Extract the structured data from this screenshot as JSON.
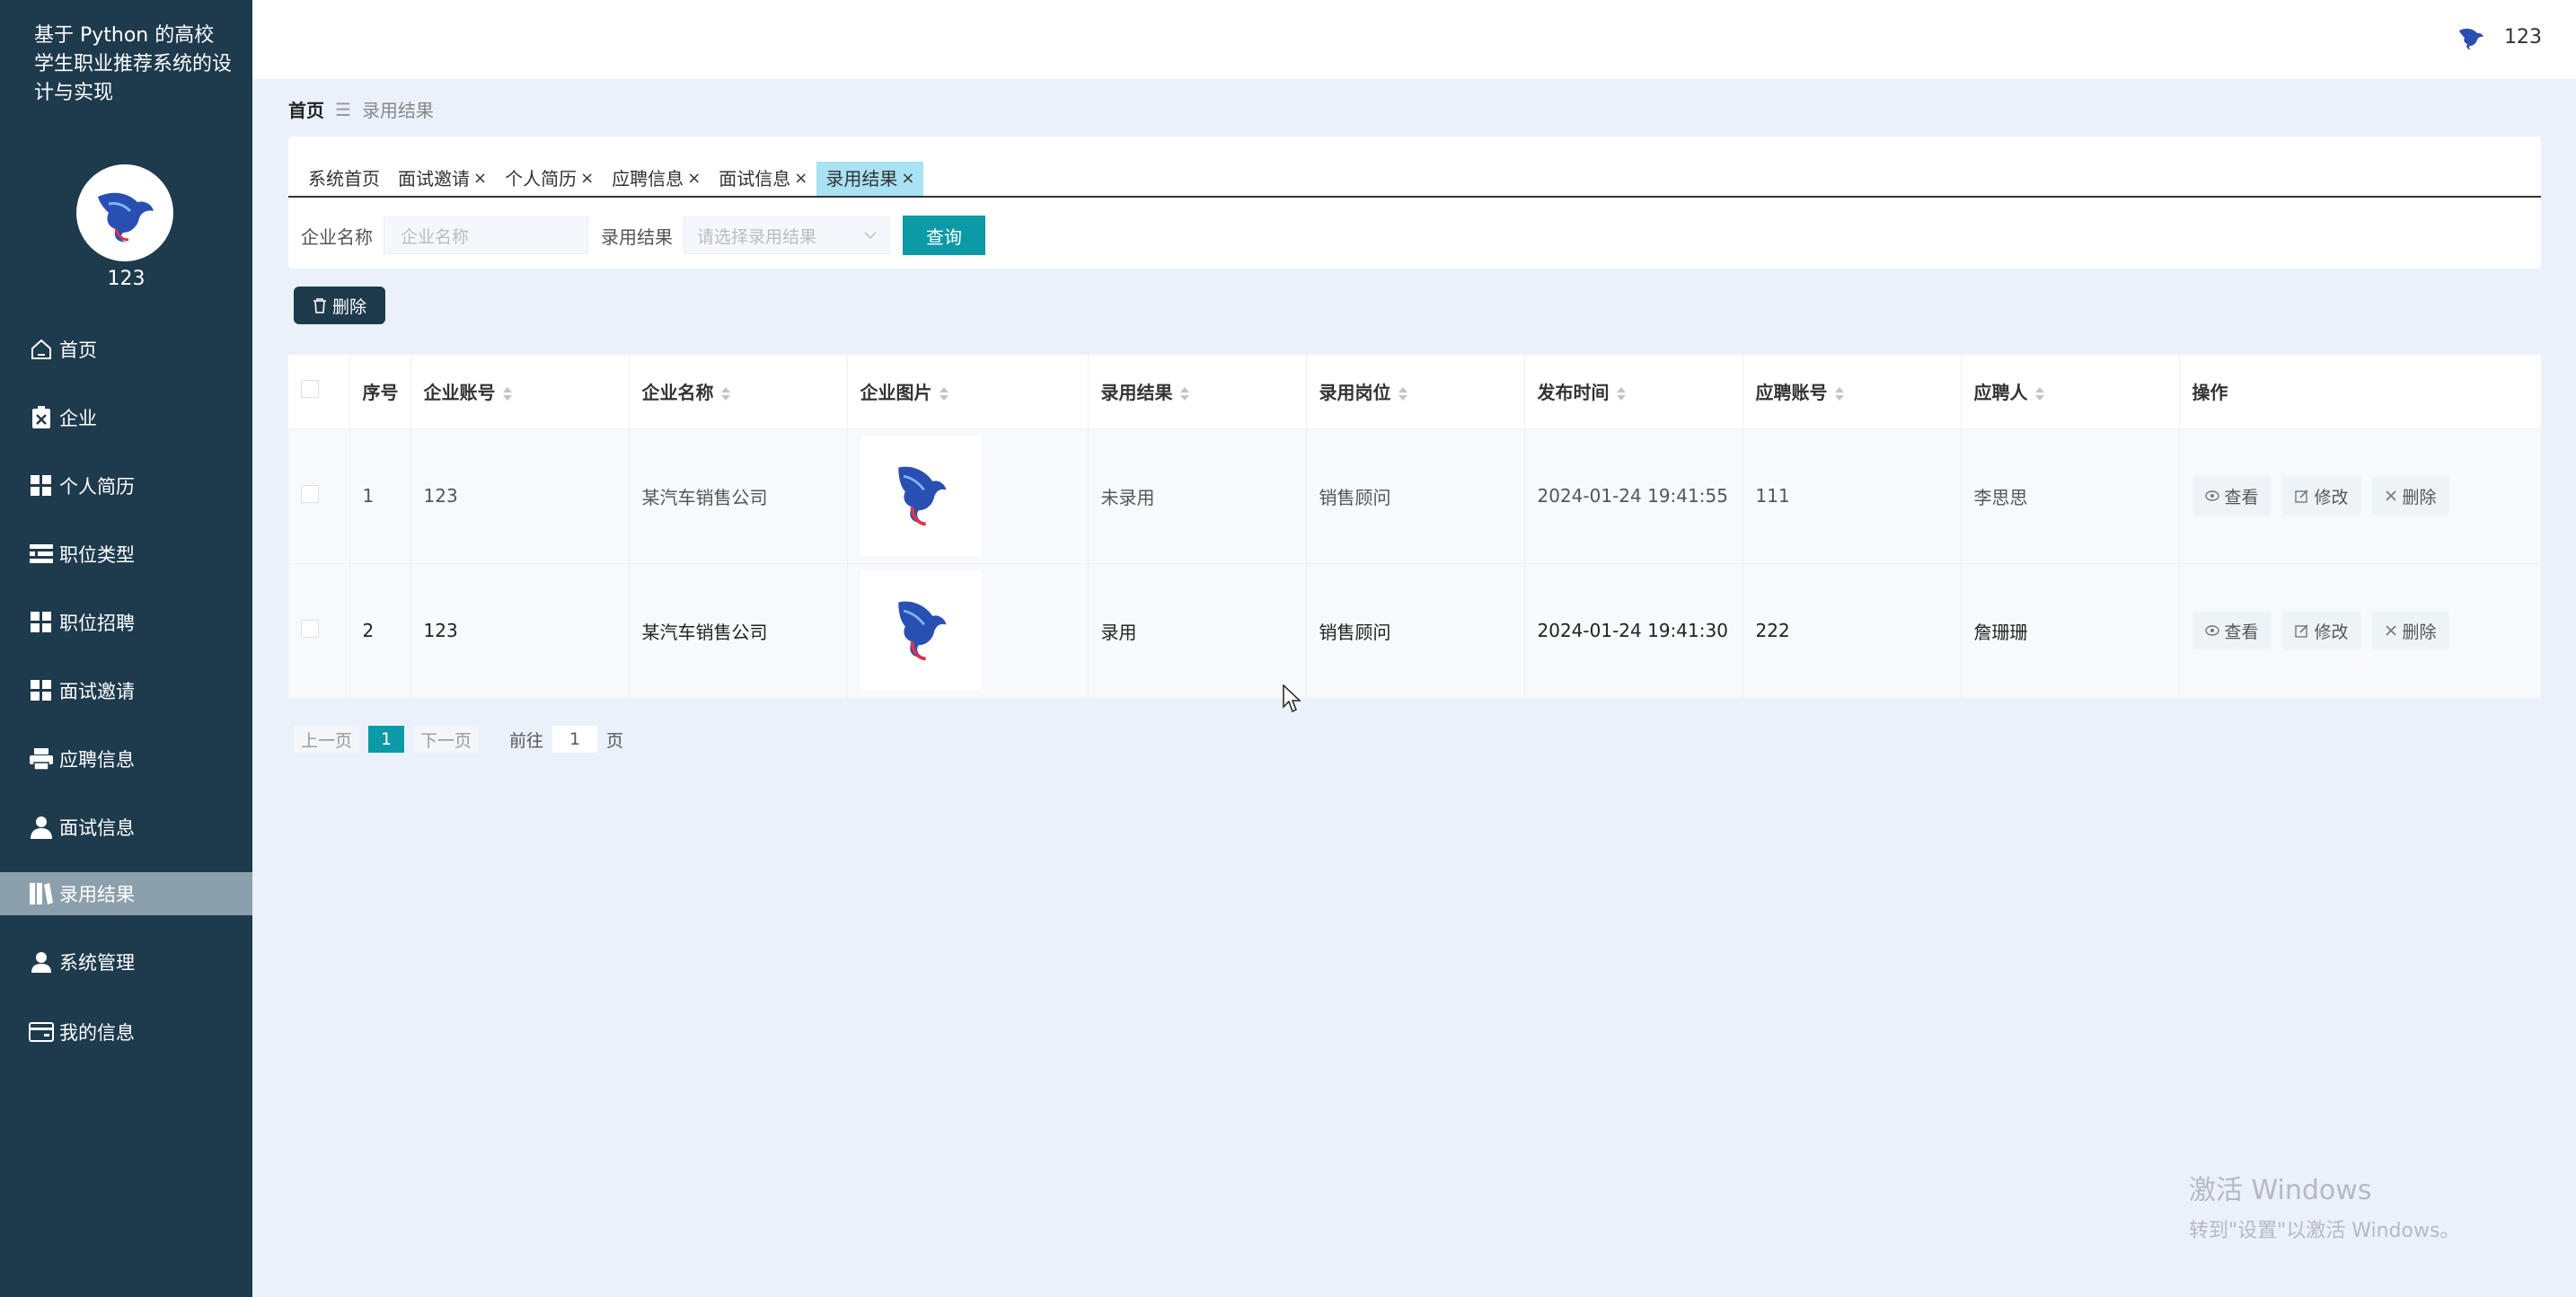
{
  "app": {
    "title": "基于 Python 的高校学生职业推荐系统的设计与实现",
    "username": "123"
  },
  "sidebar": {
    "avatar_name": "123",
    "items": [
      {
        "label": "首页",
        "icon": "home-icon"
      },
      {
        "label": "企业",
        "icon": "clipboard-icon"
      },
      {
        "label": "个人简历",
        "icon": "grid-icon"
      },
      {
        "label": "职位类型",
        "icon": "list-icon"
      },
      {
        "label": "职位招聘",
        "icon": "grid-icon"
      },
      {
        "label": "面试邀请",
        "icon": "grid-icon"
      },
      {
        "label": "应聘信息",
        "icon": "printer-icon"
      },
      {
        "label": "面试信息",
        "icon": "user-icon"
      },
      {
        "label": "录用结果",
        "icon": "book-icon",
        "active": true
      },
      {
        "label": "系统管理",
        "icon": "user-icon"
      },
      {
        "label": "我的信息",
        "icon": "card-icon"
      }
    ]
  },
  "breadcrumb": {
    "home": "首页",
    "separator": "☰",
    "current": "录用结果"
  },
  "tabs": [
    {
      "label": "系统首页",
      "closable": false
    },
    {
      "label": "面试邀请",
      "closable": true
    },
    {
      "label": "个人简历",
      "closable": true
    },
    {
      "label": "应聘信息",
      "closable": true
    },
    {
      "label": "面试信息",
      "closable": true
    },
    {
      "label": "录用结果",
      "closable": true,
      "active": true
    }
  ],
  "search": {
    "company_label": "企业名称",
    "company_placeholder": "企业名称",
    "result_label": "录用结果",
    "result_placeholder": "请选择录用结果",
    "query_button": "查询"
  },
  "toolbar": {
    "delete_button": "删除"
  },
  "table": {
    "headers": [
      "序号",
      "企业账号",
      "企业名称",
      "企业图片",
      "录用结果",
      "录用岗位",
      "发布时间",
      "应聘账号",
      "应聘人",
      "操作"
    ],
    "rows": [
      {
        "index": "1",
        "company_account": "123",
        "company_name": "某汽车销售公司",
        "result": "未录用",
        "position": "销售顾问",
        "time": "2024-01-24 19:41:55",
        "applicant_account": "111",
        "applicant": "李思思"
      },
      {
        "index": "2",
        "company_account": "123",
        "company_name": "某汽车销售公司",
        "result": "录用",
        "position": "销售顾问",
        "time": "2024-01-24 19:41:30",
        "applicant_account": "222",
        "applicant": "詹珊珊"
      }
    ],
    "actions": {
      "view": "查看",
      "edit": "修改",
      "delete": "删除"
    }
  },
  "pagination": {
    "prev": "上一页",
    "current": "1",
    "next": "下一页",
    "goto_label": "前往",
    "goto_value": "1",
    "page_unit": "页"
  },
  "watermark": {
    "line1": "激活 Windows",
    "line2": "转到\"设置\"以激活 Windows。"
  },
  "colors": {
    "sidebar": "#1e3a4d",
    "accent": "#0b9aa6",
    "active_tab": "#a8e2f3",
    "background": "#eaf1fb"
  }
}
